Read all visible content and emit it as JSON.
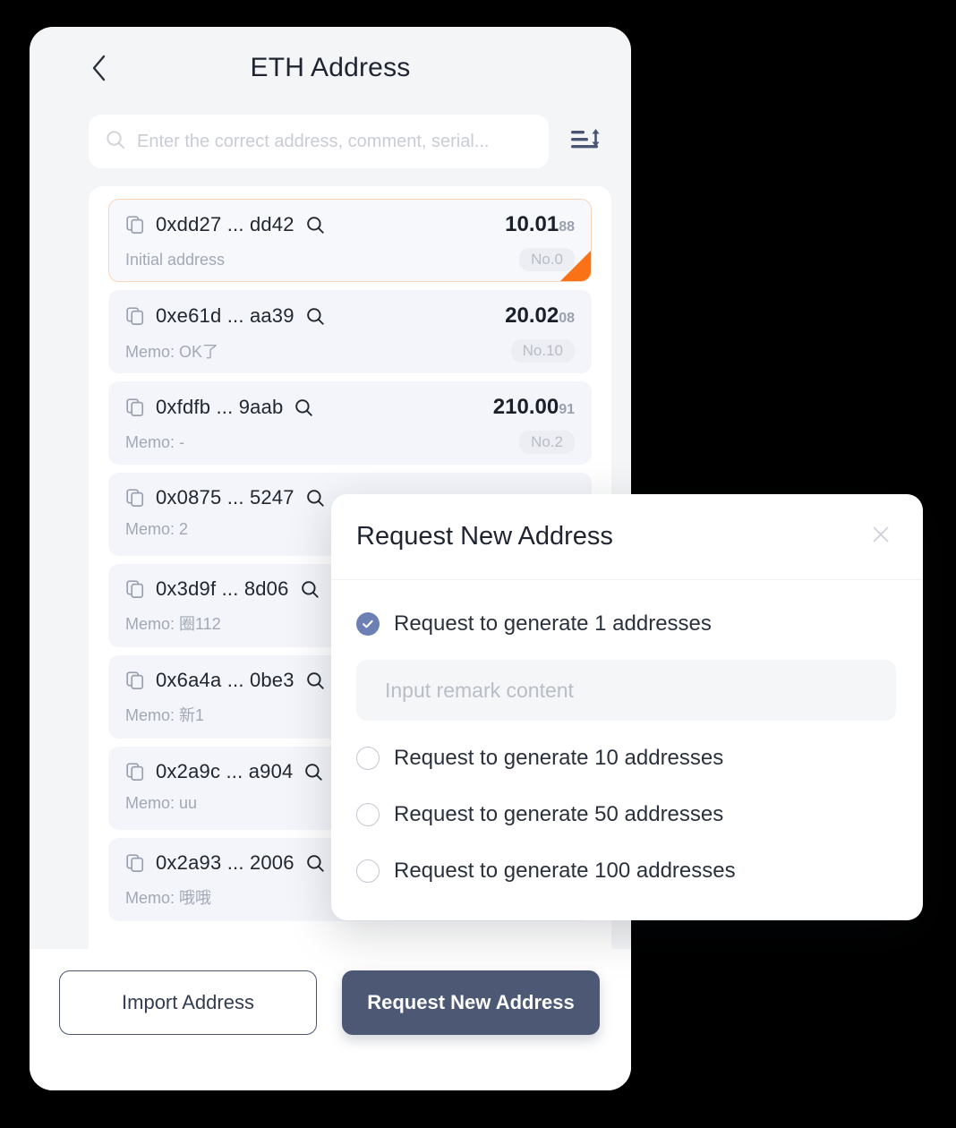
{
  "header": {
    "back_icon": "chevron-left-icon",
    "title": "ETH Address"
  },
  "search": {
    "icon": "search-icon",
    "placeholder": "Enter the correct address, comment, serial...",
    "value": "",
    "sort_icon": "sort-icon"
  },
  "addresses": [
    {
      "copy_icon": "copy-icon",
      "address": "0xdd27 ... dd42",
      "search_icon": "search-icon",
      "balance_int": "10.01",
      "balance_frac": "88",
      "memo": "Initial address",
      "serial": "No.0",
      "highlight": true
    },
    {
      "copy_icon": "copy-icon",
      "address": "0xe61d ... aa39",
      "search_icon": "search-icon",
      "balance_int": "20.02",
      "balance_frac": "08",
      "memo": "Memo: OK了",
      "serial": "No.10",
      "highlight": false
    },
    {
      "copy_icon": "copy-icon",
      "address": "0xfdfb ... 9aab",
      "search_icon": "search-icon",
      "balance_int": "210.00",
      "balance_frac": "91",
      "memo": "Memo: -",
      "serial": "No.2",
      "highlight": false
    },
    {
      "copy_icon": "copy-icon",
      "address": "0x0875 ... 5247",
      "search_icon": "search-icon",
      "balance_int": "",
      "balance_frac": "",
      "memo": "Memo: 2",
      "serial": "",
      "highlight": false
    },
    {
      "copy_icon": "copy-icon",
      "address": "0x3d9f ... 8d06",
      "search_icon": "search-icon",
      "balance_int": "",
      "balance_frac": "",
      "memo": "Memo: 圈112",
      "serial": "",
      "highlight": false
    },
    {
      "copy_icon": "copy-icon",
      "address": "0x6a4a ... 0be3",
      "search_icon": "search-icon",
      "balance_int": "",
      "balance_frac": "",
      "memo": "Memo: 新1",
      "serial": "",
      "highlight": false
    },
    {
      "copy_icon": "copy-icon",
      "address": "0x2a9c ... a904",
      "search_icon": "search-icon",
      "balance_int": "",
      "balance_frac": "",
      "memo": "Memo: uu",
      "serial": "",
      "highlight": false
    },
    {
      "copy_icon": "copy-icon",
      "address": "0x2a93 ... 2006",
      "search_icon": "search-icon",
      "balance_int": "",
      "balance_frac": "",
      "memo": "Memo: 哦哦",
      "serial": "",
      "highlight": false
    }
  ],
  "footer": {
    "import_label": "Import Address",
    "request_label": "Request New Address"
  },
  "modal": {
    "title": "Request New Address",
    "close_icon": "close-icon",
    "options": [
      {
        "label": "Request to generate 1 addresses",
        "selected": true
      },
      {
        "label": "Request to generate 10 addresses",
        "selected": false
      },
      {
        "label": "Request to generate 50 addresses",
        "selected": false
      },
      {
        "label": "Request to generate 100 addresses",
        "selected": false
      }
    ],
    "remark": {
      "placeholder": "Input remark content",
      "value": ""
    }
  },
  "colors": {
    "background": "#000000",
    "screen": "#f4f5f7",
    "card": "#f3f5fa",
    "highlight_border": "#fbd5b5",
    "flag_orange": "#f97316",
    "accent_navy": "#4d5875",
    "radio_blue": "#6d80b3"
  }
}
